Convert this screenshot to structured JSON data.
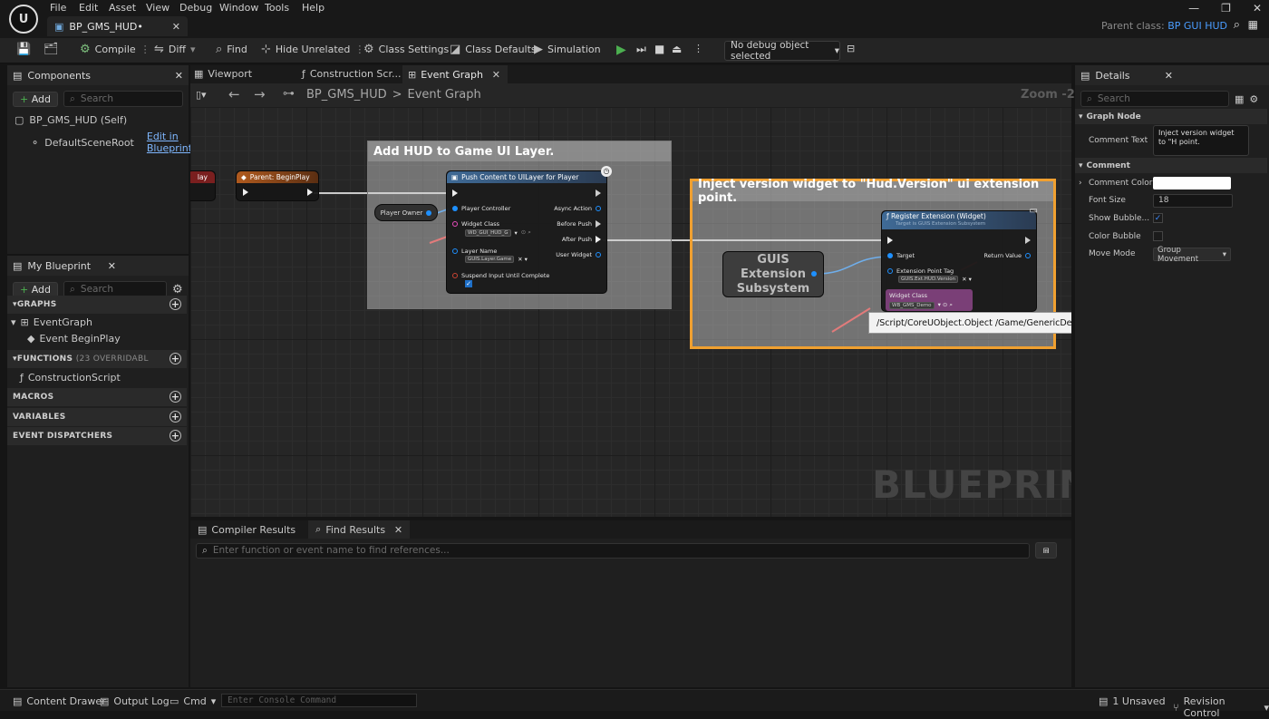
{
  "menu": {
    "items": [
      "File",
      "Edit",
      "Asset",
      "View",
      "Debug",
      "Window",
      "Tools",
      "Help"
    ],
    "doc_tab": "BP_GMS_HUD•",
    "parent_class_label": "Parent class:",
    "parent_class_value": "BP GUI HUD"
  },
  "toolbar": {
    "compile": "Compile",
    "diff": "Diff",
    "find": "Find",
    "hide_unrelated": "Hide Unrelated",
    "class_settings": "Class Settings",
    "class_defaults": "Class Defaults",
    "simulation": "Simulation",
    "debug_select": "No debug object selected"
  },
  "components": {
    "title": "Components",
    "add": "Add",
    "search_placeholder": "Search",
    "self_item": "BP_GMS_HUD (Self)",
    "root_item": "DefaultSceneRoot",
    "edit_link": "Edit in Blueprint"
  },
  "my_blueprint": {
    "title": "My Blueprint",
    "add": "Add",
    "search_placeholder": "Search",
    "graphs": "GRAPHS",
    "event_graph": "EventGraph",
    "event_begin_play": "Event BeginPlay",
    "functions": "FUNCTIONS",
    "functions_note": "(23 OVERRIDABL",
    "construction_script": "ConstructionScript",
    "macros": "MACROS",
    "variables": "VARIABLES",
    "event_dispatchers": "EVENT DISPATCHERS"
  },
  "editor_tabs": {
    "viewport": "Viewport",
    "construction": "Construction Scr...",
    "event_graph": "Event Graph"
  },
  "breadcrumb": {
    "root": "BP_GMS_HUD",
    "sep": ">",
    "current": "Event Graph",
    "zoom": "Zoom -2"
  },
  "graph": {
    "comment1": "Add HUD to Game UI Layer.",
    "comment2": "Inject version widget to \"Hud.Version\" ui extension point.",
    "partial_node": "lay",
    "parent_begin_play": "Parent: BeginPlay",
    "player_owner": "Player Owner",
    "push_node": {
      "title": "Push Content to UILayer for Player",
      "player_controller": "Player Controller",
      "widget_class": "Widget Class",
      "widget_class_value": "WD_GUI_HUD_G",
      "layer_name": "Layer Name",
      "layer_name_value": "GUIS.Layer.Game",
      "suspend": "Suspend Input Until Complete",
      "async_action": "Async Action",
      "before_push": "Before Push",
      "after_push": "After Push",
      "user_widget": "User Widget"
    },
    "guis_node": "GUIS Extension Subsystem",
    "register_node": {
      "title": "Register Extension (Widget)",
      "subtitle": "Target is GUIS Extension Subsystem",
      "target": "Target",
      "return_value": "Return Value",
      "ext_tag": "Extension Point Tag",
      "ext_tag_value": "GUIS.Ext.HUD.Version",
      "widget_class": "Widget Class",
      "widget_class_value": "WB_GMS_Demo"
    },
    "tooltip": "/Script/CoreUObject.Object /Game/GenericDemo/GMS/UI/WB_GMS_Demo_Version.WB_GMS_Demo_Version_C",
    "watermark": "BLUEPRINT"
  },
  "bottom": {
    "compiler_results": "Compiler Results",
    "find_results": "Find Results",
    "find_placeholder": "Enter function or event name to find references..."
  },
  "details": {
    "title": "Details",
    "search_placeholder": "Search",
    "graph_node_section": "Graph Node",
    "comment_text_label": "Comment Text",
    "comment_text_value": "Inject version widget to \"H point.",
    "comment_section": "Comment",
    "comment_color_label": "Comment Color",
    "font_size_label": "Font Size",
    "font_size_value": "18",
    "show_bubble_label": "Show Bubble...",
    "color_bubble_label": "Color Bubble",
    "move_mode_label": "Move Mode",
    "move_mode_value": "Group Movement"
  },
  "status": {
    "content_drawer": "Content Drawer",
    "output_log": "Output Log",
    "cmd": "Cmd",
    "console_placeholder": "Enter Console Command",
    "unsaved": "1 Unsaved",
    "revision": "Revision Control"
  },
  "colors": {
    "accent_blue": "#4a9dff",
    "comment_highlight": "#f0a030",
    "play_green": "#4caf50"
  }
}
